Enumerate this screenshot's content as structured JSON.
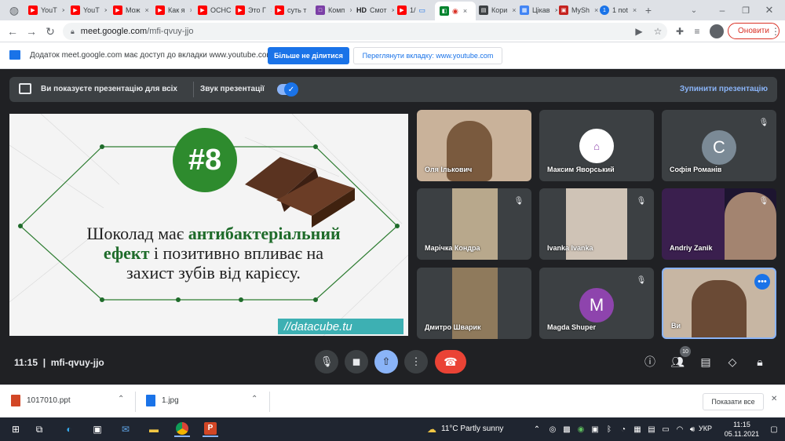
{
  "tabs": [
    {
      "label": "YouT"
    },
    {
      "label": "YouT"
    },
    {
      "label": "Мож"
    },
    {
      "label": "Как я"
    },
    {
      "label": "ОСНС"
    },
    {
      "label": "Это Г"
    },
    {
      "label": "суть т"
    },
    {
      "label": "Комп"
    },
    {
      "label": "Смот"
    },
    {
      "label": "1/"
    },
    {
      "label": ""
    },
    {
      "label": "Кори"
    },
    {
      "label": "Цікав"
    },
    {
      "label": "MySh"
    },
    {
      "label": "1 поt"
    }
  ],
  "tab_hd": "HD",
  "toolbar": {
    "url_host": "meet.google.com",
    "url_path": "/mfi-qvuy-jjo",
    "update_label": "Оновити"
  },
  "sharebar": {
    "text": "Додаток meet.google.com має доступ до вкладки www.youtube.com",
    "stop_label": "Більше не ділитися",
    "switch_label": "Переглянути вкладку: www.youtube.com"
  },
  "present_bar": {
    "label": "Ви показуєте презентацію для всіх",
    "sound_label": "Звук презентації",
    "stop_label": "Зупинити презентацію"
  },
  "slide": {
    "badge": "#8",
    "line1_a": "Шоколад має ",
    "line1_b": "антибактеріальний",
    "line2_a": "ефект",
    "line2_b": " і позитивно впливає на",
    "line3": "захист зубів від карієсу.",
    "watermark": "//datacube.tu"
  },
  "participants": [
    {
      "name": "Оля Ількович"
    },
    {
      "name": "Максим Яворський"
    },
    {
      "name": "Софія Романів",
      "letter": "С"
    },
    {
      "name": "Марічка Кондра"
    },
    {
      "name": "Ivanka Ivanka"
    },
    {
      "name": "Andriy Zanik"
    },
    {
      "name": "Дмитро Шварик"
    },
    {
      "name": "Magda Shuper",
      "letter": "M"
    },
    {
      "name": "Ви"
    }
  ],
  "call": {
    "time": "11:15",
    "code": "mfi-qvuy-jjo",
    "people_count": "10"
  },
  "downloads": {
    "file1": "1017010.ppt",
    "file2": "1.jpg",
    "show_all": "Показати все"
  },
  "taskbar": {
    "weather": "11°C  Partly sunny",
    "lang": "УКР",
    "time": "11:15",
    "date": "05.11.2021"
  },
  "colors": {
    "accent": "#1a73e8",
    "end_call": "#ea4335",
    "slide_green": "#2e8b2e",
    "avatar_s": "#7b8a96",
    "avatar_m": "#8e44ad"
  }
}
